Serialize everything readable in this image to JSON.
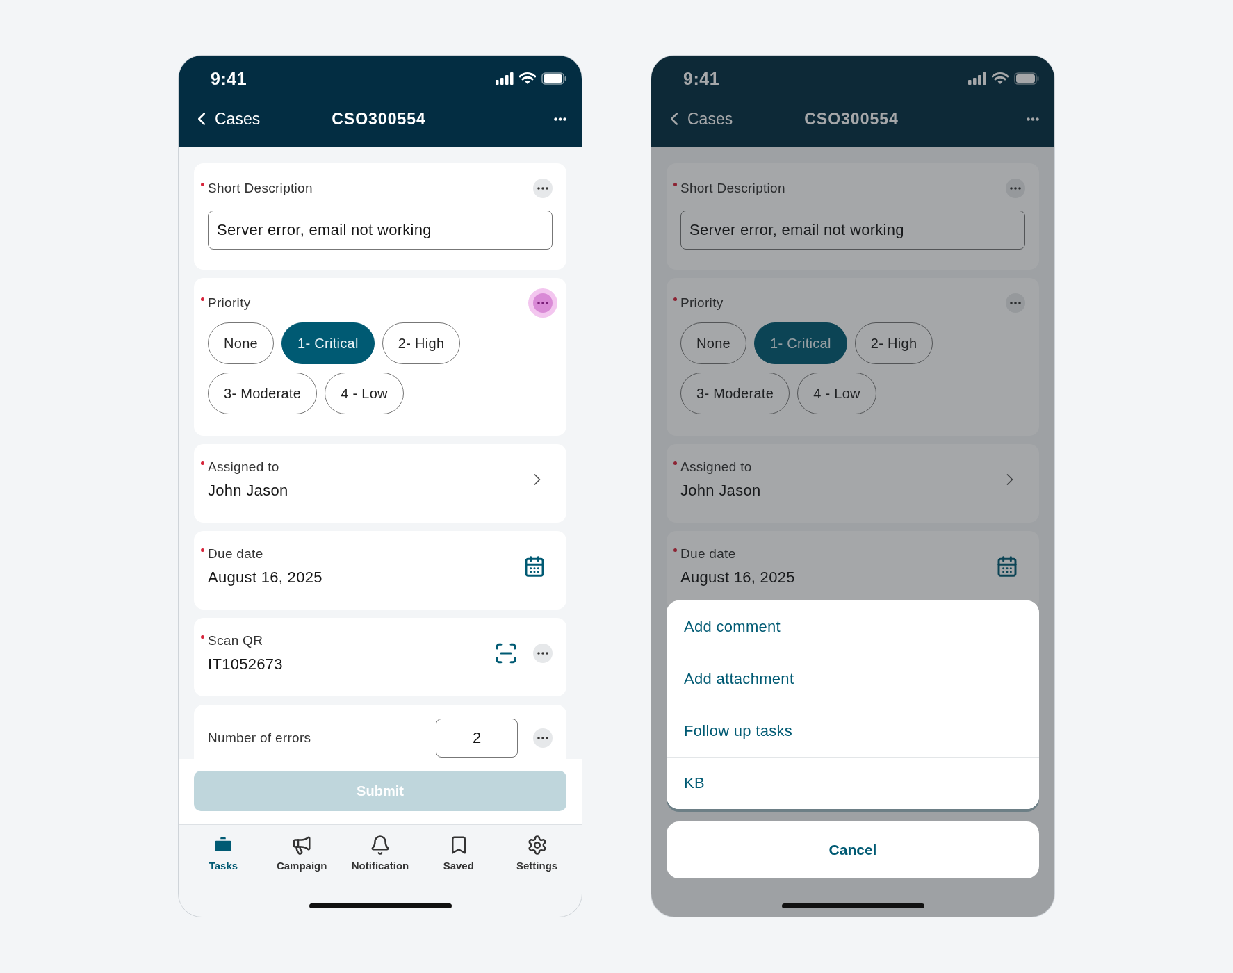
{
  "screens": [
    {
      "status": {
        "time": "9:41"
      },
      "nav": {
        "back": "Cases",
        "title": "CSO300554"
      },
      "fields": [
        {
          "kind": "text_input",
          "label": "Short Description",
          "required": true,
          "value": "Server error, email not working",
          "more_highlighted": false
        },
        {
          "kind": "choice",
          "label": "Priority",
          "required": true,
          "more_highlighted": true,
          "options": [
            {
              "label": "None",
              "selected": false
            },
            {
              "label": "1- Critical",
              "selected": true
            },
            {
              "label": "2- High",
              "selected": false
            },
            {
              "label": "3- Moderate",
              "selected": false
            },
            {
              "label": "4 - Low",
              "selected": false
            }
          ]
        },
        {
          "kind": "link",
          "label": "Assigned to",
          "required": true,
          "value": "John Jason"
        },
        {
          "kind": "date",
          "label": "Due date",
          "required": true,
          "value": "August 16, 2025"
        },
        {
          "kind": "scan",
          "label": "Scan QR",
          "required": true,
          "value": "IT1052673",
          "more_highlighted": false
        },
        {
          "kind": "number",
          "label": "Number of errors",
          "required": false,
          "value": "2",
          "more_highlighted": false
        }
      ],
      "submit": {
        "label": "Submit",
        "disabled": true
      },
      "tabs": [
        {
          "label": "Tasks",
          "selected": true
        },
        {
          "label": "Campaign",
          "selected": false
        },
        {
          "label": "Notification",
          "selected": false
        },
        {
          "label": "Saved",
          "selected": false
        },
        {
          "label": "Settings",
          "selected": false
        }
      ]
    },
    {
      "status": {
        "time": "9:41"
      },
      "nav": {
        "back": "Cases",
        "title": "CSO300554"
      },
      "fields": [
        {
          "kind": "text_input",
          "label": "Short Description",
          "required": true,
          "value": "Server error, email not working",
          "more_highlighted": false
        },
        {
          "kind": "choice",
          "label": "Priority",
          "required": true,
          "more_highlighted": false,
          "options": [
            {
              "label": "None",
              "selected": false
            },
            {
              "label": "1- Critical",
              "selected": true
            },
            {
              "label": "2- High",
              "selected": false
            },
            {
              "label": "3- Moderate",
              "selected": false
            },
            {
              "label": "4 - Low",
              "selected": false
            }
          ]
        },
        {
          "kind": "link",
          "label": "Assigned to",
          "required": true,
          "value": "John Jason"
        },
        {
          "kind": "date",
          "label": "Due date",
          "required": true,
          "value": "August 16, 2025"
        }
      ],
      "action_sheet": {
        "items": [
          "Add comment",
          "Add attachment",
          "Follow up tasks",
          "KB"
        ],
        "cancel": "Cancel"
      }
    }
  ]
}
